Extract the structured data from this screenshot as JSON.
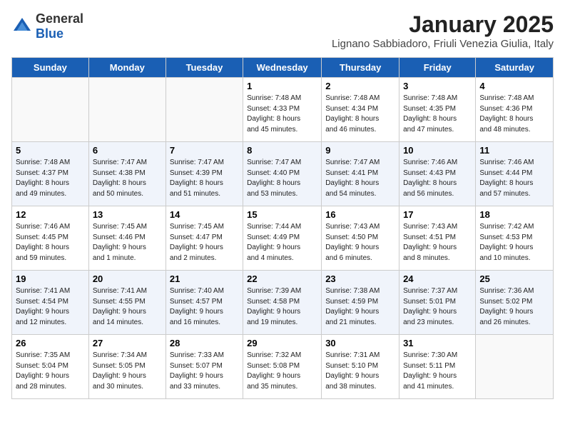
{
  "header": {
    "logo_general": "General",
    "logo_blue": "Blue",
    "month_title": "January 2025",
    "location": "Lignano Sabbiadoro, Friuli Venezia Giulia, Italy"
  },
  "weekdays": [
    "Sunday",
    "Monday",
    "Tuesday",
    "Wednesday",
    "Thursday",
    "Friday",
    "Saturday"
  ],
  "weeks": [
    [
      {
        "day": "",
        "info": ""
      },
      {
        "day": "",
        "info": ""
      },
      {
        "day": "",
        "info": ""
      },
      {
        "day": "1",
        "info": "Sunrise: 7:48 AM\nSunset: 4:33 PM\nDaylight: 8 hours\nand 45 minutes."
      },
      {
        "day": "2",
        "info": "Sunrise: 7:48 AM\nSunset: 4:34 PM\nDaylight: 8 hours\nand 46 minutes."
      },
      {
        "day": "3",
        "info": "Sunrise: 7:48 AM\nSunset: 4:35 PM\nDaylight: 8 hours\nand 47 minutes."
      },
      {
        "day": "4",
        "info": "Sunrise: 7:48 AM\nSunset: 4:36 PM\nDaylight: 8 hours\nand 48 minutes."
      }
    ],
    [
      {
        "day": "5",
        "info": "Sunrise: 7:48 AM\nSunset: 4:37 PM\nDaylight: 8 hours\nand 49 minutes."
      },
      {
        "day": "6",
        "info": "Sunrise: 7:47 AM\nSunset: 4:38 PM\nDaylight: 8 hours\nand 50 minutes."
      },
      {
        "day": "7",
        "info": "Sunrise: 7:47 AM\nSunset: 4:39 PM\nDaylight: 8 hours\nand 51 minutes."
      },
      {
        "day": "8",
        "info": "Sunrise: 7:47 AM\nSunset: 4:40 PM\nDaylight: 8 hours\nand 53 minutes."
      },
      {
        "day": "9",
        "info": "Sunrise: 7:47 AM\nSunset: 4:41 PM\nDaylight: 8 hours\nand 54 minutes."
      },
      {
        "day": "10",
        "info": "Sunrise: 7:46 AM\nSunset: 4:43 PM\nDaylight: 8 hours\nand 56 minutes."
      },
      {
        "day": "11",
        "info": "Sunrise: 7:46 AM\nSunset: 4:44 PM\nDaylight: 8 hours\nand 57 minutes."
      }
    ],
    [
      {
        "day": "12",
        "info": "Sunrise: 7:46 AM\nSunset: 4:45 PM\nDaylight: 8 hours\nand 59 minutes."
      },
      {
        "day": "13",
        "info": "Sunrise: 7:45 AM\nSunset: 4:46 PM\nDaylight: 9 hours\nand 1 minute."
      },
      {
        "day": "14",
        "info": "Sunrise: 7:45 AM\nSunset: 4:47 PM\nDaylight: 9 hours\nand 2 minutes."
      },
      {
        "day": "15",
        "info": "Sunrise: 7:44 AM\nSunset: 4:49 PM\nDaylight: 9 hours\nand 4 minutes."
      },
      {
        "day": "16",
        "info": "Sunrise: 7:43 AM\nSunset: 4:50 PM\nDaylight: 9 hours\nand 6 minutes."
      },
      {
        "day": "17",
        "info": "Sunrise: 7:43 AM\nSunset: 4:51 PM\nDaylight: 9 hours\nand 8 minutes."
      },
      {
        "day": "18",
        "info": "Sunrise: 7:42 AM\nSunset: 4:53 PM\nDaylight: 9 hours\nand 10 minutes."
      }
    ],
    [
      {
        "day": "19",
        "info": "Sunrise: 7:41 AM\nSunset: 4:54 PM\nDaylight: 9 hours\nand 12 minutes."
      },
      {
        "day": "20",
        "info": "Sunrise: 7:41 AM\nSunset: 4:55 PM\nDaylight: 9 hours\nand 14 minutes."
      },
      {
        "day": "21",
        "info": "Sunrise: 7:40 AM\nSunset: 4:57 PM\nDaylight: 9 hours\nand 16 minutes."
      },
      {
        "day": "22",
        "info": "Sunrise: 7:39 AM\nSunset: 4:58 PM\nDaylight: 9 hours\nand 19 minutes."
      },
      {
        "day": "23",
        "info": "Sunrise: 7:38 AM\nSunset: 4:59 PM\nDaylight: 9 hours\nand 21 minutes."
      },
      {
        "day": "24",
        "info": "Sunrise: 7:37 AM\nSunset: 5:01 PM\nDaylight: 9 hours\nand 23 minutes."
      },
      {
        "day": "25",
        "info": "Sunrise: 7:36 AM\nSunset: 5:02 PM\nDaylight: 9 hours\nand 26 minutes."
      }
    ],
    [
      {
        "day": "26",
        "info": "Sunrise: 7:35 AM\nSunset: 5:04 PM\nDaylight: 9 hours\nand 28 minutes."
      },
      {
        "day": "27",
        "info": "Sunrise: 7:34 AM\nSunset: 5:05 PM\nDaylight: 9 hours\nand 30 minutes."
      },
      {
        "day": "28",
        "info": "Sunrise: 7:33 AM\nSunset: 5:07 PM\nDaylight: 9 hours\nand 33 minutes."
      },
      {
        "day": "29",
        "info": "Sunrise: 7:32 AM\nSunset: 5:08 PM\nDaylight: 9 hours\nand 35 minutes."
      },
      {
        "day": "30",
        "info": "Sunrise: 7:31 AM\nSunset: 5:10 PM\nDaylight: 9 hours\nand 38 minutes."
      },
      {
        "day": "31",
        "info": "Sunrise: 7:30 AM\nSunset: 5:11 PM\nDaylight: 9 hours\nand 41 minutes."
      },
      {
        "day": "",
        "info": ""
      }
    ]
  ]
}
